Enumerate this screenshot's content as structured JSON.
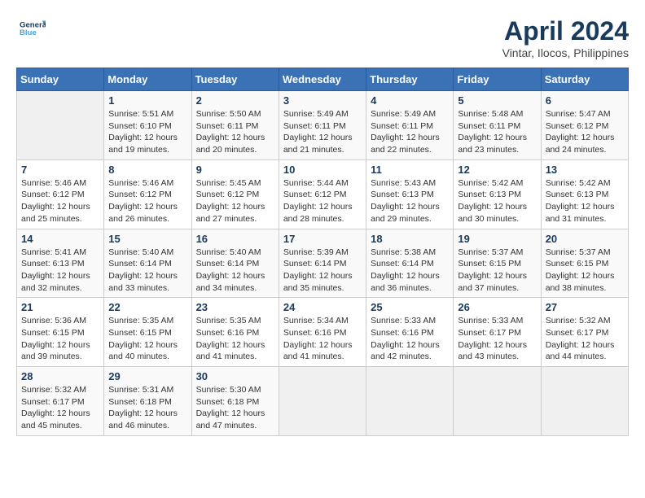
{
  "header": {
    "logo_line1": "General",
    "logo_line2": "Blue",
    "month": "April 2024",
    "location": "Vintar, Ilocos, Philippines"
  },
  "days_of_week": [
    "Sunday",
    "Monday",
    "Tuesday",
    "Wednesday",
    "Thursday",
    "Friday",
    "Saturday"
  ],
  "weeks": [
    [
      {
        "day": "",
        "info": ""
      },
      {
        "day": "1",
        "info": "Sunrise: 5:51 AM\nSunset: 6:10 PM\nDaylight: 12 hours\nand 19 minutes."
      },
      {
        "day": "2",
        "info": "Sunrise: 5:50 AM\nSunset: 6:11 PM\nDaylight: 12 hours\nand 20 minutes."
      },
      {
        "day": "3",
        "info": "Sunrise: 5:49 AM\nSunset: 6:11 PM\nDaylight: 12 hours\nand 21 minutes."
      },
      {
        "day": "4",
        "info": "Sunrise: 5:49 AM\nSunset: 6:11 PM\nDaylight: 12 hours\nand 22 minutes."
      },
      {
        "day": "5",
        "info": "Sunrise: 5:48 AM\nSunset: 6:11 PM\nDaylight: 12 hours\nand 23 minutes."
      },
      {
        "day": "6",
        "info": "Sunrise: 5:47 AM\nSunset: 6:12 PM\nDaylight: 12 hours\nand 24 minutes."
      }
    ],
    [
      {
        "day": "7",
        "info": "Sunrise: 5:46 AM\nSunset: 6:12 PM\nDaylight: 12 hours\nand 25 minutes."
      },
      {
        "day": "8",
        "info": "Sunrise: 5:46 AM\nSunset: 6:12 PM\nDaylight: 12 hours\nand 26 minutes."
      },
      {
        "day": "9",
        "info": "Sunrise: 5:45 AM\nSunset: 6:12 PM\nDaylight: 12 hours\nand 27 minutes."
      },
      {
        "day": "10",
        "info": "Sunrise: 5:44 AM\nSunset: 6:12 PM\nDaylight: 12 hours\nand 28 minutes."
      },
      {
        "day": "11",
        "info": "Sunrise: 5:43 AM\nSunset: 6:13 PM\nDaylight: 12 hours\nand 29 minutes."
      },
      {
        "day": "12",
        "info": "Sunrise: 5:42 AM\nSunset: 6:13 PM\nDaylight: 12 hours\nand 30 minutes."
      },
      {
        "day": "13",
        "info": "Sunrise: 5:42 AM\nSunset: 6:13 PM\nDaylight: 12 hours\nand 31 minutes."
      }
    ],
    [
      {
        "day": "14",
        "info": "Sunrise: 5:41 AM\nSunset: 6:13 PM\nDaylight: 12 hours\nand 32 minutes."
      },
      {
        "day": "15",
        "info": "Sunrise: 5:40 AM\nSunset: 6:14 PM\nDaylight: 12 hours\nand 33 minutes."
      },
      {
        "day": "16",
        "info": "Sunrise: 5:40 AM\nSunset: 6:14 PM\nDaylight: 12 hours\nand 34 minutes."
      },
      {
        "day": "17",
        "info": "Sunrise: 5:39 AM\nSunset: 6:14 PM\nDaylight: 12 hours\nand 35 minutes."
      },
      {
        "day": "18",
        "info": "Sunrise: 5:38 AM\nSunset: 6:14 PM\nDaylight: 12 hours\nand 36 minutes."
      },
      {
        "day": "19",
        "info": "Sunrise: 5:37 AM\nSunset: 6:15 PM\nDaylight: 12 hours\nand 37 minutes."
      },
      {
        "day": "20",
        "info": "Sunrise: 5:37 AM\nSunset: 6:15 PM\nDaylight: 12 hours\nand 38 minutes."
      }
    ],
    [
      {
        "day": "21",
        "info": "Sunrise: 5:36 AM\nSunset: 6:15 PM\nDaylight: 12 hours\nand 39 minutes."
      },
      {
        "day": "22",
        "info": "Sunrise: 5:35 AM\nSunset: 6:15 PM\nDaylight: 12 hours\nand 40 minutes."
      },
      {
        "day": "23",
        "info": "Sunrise: 5:35 AM\nSunset: 6:16 PM\nDaylight: 12 hours\nand 41 minutes."
      },
      {
        "day": "24",
        "info": "Sunrise: 5:34 AM\nSunset: 6:16 PM\nDaylight: 12 hours\nand 41 minutes."
      },
      {
        "day": "25",
        "info": "Sunrise: 5:33 AM\nSunset: 6:16 PM\nDaylight: 12 hours\nand 42 minutes."
      },
      {
        "day": "26",
        "info": "Sunrise: 5:33 AM\nSunset: 6:17 PM\nDaylight: 12 hours\nand 43 minutes."
      },
      {
        "day": "27",
        "info": "Sunrise: 5:32 AM\nSunset: 6:17 PM\nDaylight: 12 hours\nand 44 minutes."
      }
    ],
    [
      {
        "day": "28",
        "info": "Sunrise: 5:32 AM\nSunset: 6:17 PM\nDaylight: 12 hours\nand 45 minutes."
      },
      {
        "day": "29",
        "info": "Sunrise: 5:31 AM\nSunset: 6:18 PM\nDaylight: 12 hours\nand 46 minutes."
      },
      {
        "day": "30",
        "info": "Sunrise: 5:30 AM\nSunset: 6:18 PM\nDaylight: 12 hours\nand 47 minutes."
      },
      {
        "day": "",
        "info": ""
      },
      {
        "day": "",
        "info": ""
      },
      {
        "day": "",
        "info": ""
      },
      {
        "day": "",
        "info": ""
      }
    ]
  ]
}
